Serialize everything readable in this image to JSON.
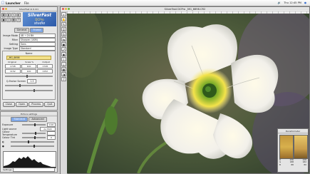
{
  "menubar": {
    "app": "Launcher",
    "menus": [
      "File"
    ],
    "clock": "Thu 12:45 PM"
  },
  "palette": {
    "title": "SilverFast Ai 6.4r1",
    "logo": {
      "line1": "SilverFast",
      "line2": "DCPro",
      "line3": "studio"
    },
    "tabs": [
      "General",
      "Frame"
    ],
    "fields": [
      {
        "label": "Image Mode",
        "value": "48 → 24 Bit"
      },
      {
        "label": "Filter",
        "value": "Sharpen (USM)"
      },
      {
        "label": "Setting",
        "value": "Sans"
      },
      {
        "label": "Image Type",
        "value": "Standard"
      }
    ],
    "frame": {
      "header": "Name",
      "name_value": "_MG_6698",
      "cols": [
        "Original",
        "Scale %",
        "Output"
      ],
      "values": [
        "1728",
        "100",
        "1728"
      ],
      "values2": [
        "1152",
        "100",
        "1152"
      ],
      "filter_label": "Q-Factor Screen",
      "filter_value": "1.5"
    },
    "buttons": [
      "Close",
      "Open",
      "Process",
      "Quit"
    ]
  },
  "histpanel": {
    "title": "Picture settings",
    "tabs": [
      "Standard",
      "Advanced"
    ],
    "rows": [
      {
        "label": "Exposure",
        "value": "0.00"
      },
      {
        "label": "Light source",
        "value": "As Shot"
      },
      {
        "label": "Colour Temperature",
        "value": ""
      },
      {
        "label": "Colour Tint",
        "value": "0"
      }
    ],
    "footer": "Settings"
  },
  "main": {
    "title": "SilverFast DCPro _MG_6698.CR2"
  },
  "densitometer": {
    "title": "Densitometer",
    "values": [
      {
        "k": "R",
        "a": "230",
        "b": "228"
      },
      {
        "k": "G",
        "a": "188",
        "b": "182"
      },
      {
        "k": "B",
        "a": "88",
        "b": "80"
      }
    ]
  }
}
